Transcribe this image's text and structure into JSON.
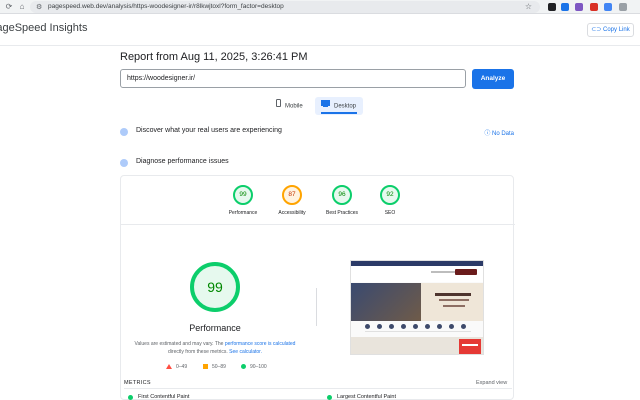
{
  "browser": {
    "url": "pagespeed.web.dev/analysis/https-woodesigner-ir/r8lkwjtoxl?form_factor=desktop"
  },
  "header": {
    "title": "PageSpeed Insights",
    "copy_link": "Copy Link"
  },
  "report": {
    "title": "Report from Aug 11, 2025, 3:26:41 PM",
    "url_value": "https://woodesigner.ir/",
    "analyze_label": "Analyze",
    "tabs": [
      {
        "label": "Mobile",
        "selected": false
      },
      {
        "label": "Desktop",
        "selected": true
      }
    ]
  },
  "sections": {
    "real_users": "Discover what your real users are experiencing",
    "no_data": "No Data",
    "diagnose": "Diagnose performance issues"
  },
  "scores": [
    {
      "label": "Performance",
      "value": "99",
      "color": "#0cce6b"
    },
    {
      "label": "Accessibility",
      "value": "87",
      "color": "#ffa400"
    },
    {
      "label": "Best Practices",
      "value": "96",
      "color": "#0cce6b"
    },
    {
      "label": "SEO",
      "value": "92",
      "color": "#0cce6b"
    }
  ],
  "performance": {
    "score": "99",
    "label": "Performance",
    "note_1": "Values are estimated and may vary. The",
    "note_link_1": "performance score is calculated",
    "note_2": "directly from these metrics.",
    "note_link_2": "See calculator."
  },
  "legend": [
    {
      "range": "0–49",
      "color": "#ff4e42"
    },
    {
      "range": "50–89",
      "color": "#ffa400"
    },
    {
      "range": "90–100",
      "color": "#0cce6b"
    }
  ],
  "metrics": {
    "heading": "METRICS",
    "expand": "Expand view",
    "items": [
      "First Contentful Paint",
      "Largest Contentful Paint"
    ]
  }
}
